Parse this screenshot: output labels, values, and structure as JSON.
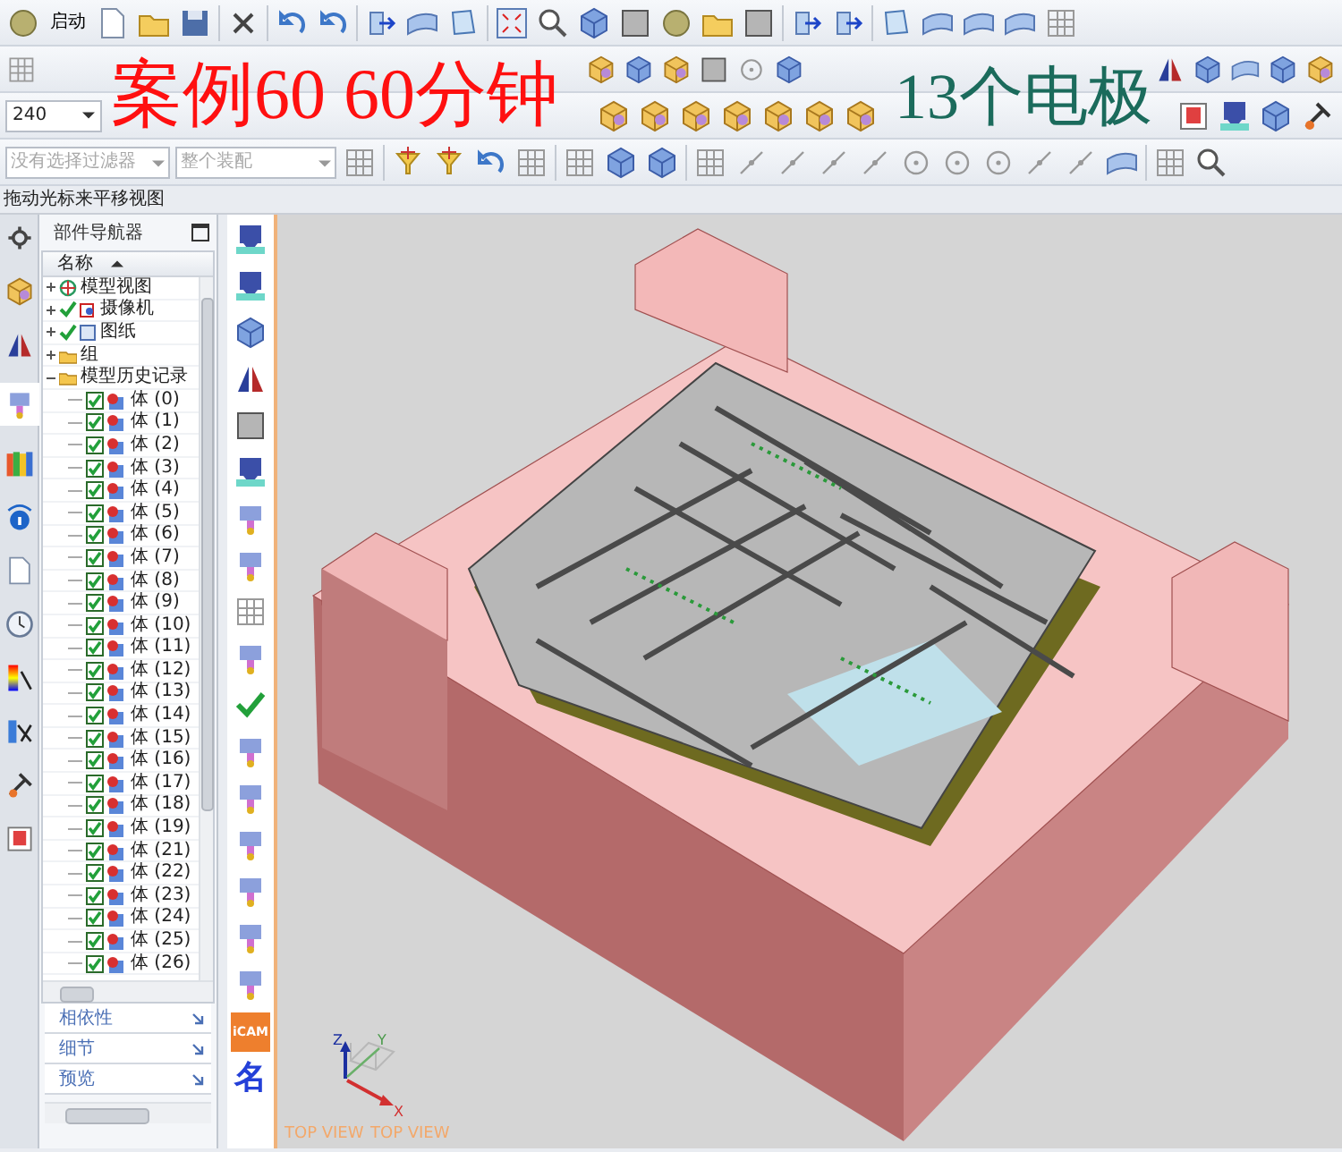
{
  "toolbar": {
    "start_button": "启动",
    "zoom_value": "240",
    "selection_filter": {
      "placeholder": "没有选择过滤器"
    },
    "assembly_scope": {
      "placeholder": "整个装配"
    }
  },
  "captions": [
    {
      "text": "案例60  60分钟",
      "kind": "title"
    },
    {
      "text": "13个电极",
      "kind": "note"
    }
  ],
  "status_line": "拖动光标来平移视图",
  "navigator": {
    "title": "部件导航器",
    "column": "名称",
    "tree": [
      {
        "label": "模型视图",
        "kind": "view",
        "expanded": false,
        "checked": false
      },
      {
        "label": "摄像机",
        "kind": "camera",
        "expanded": false,
        "checked": true
      },
      {
        "label": "图纸",
        "kind": "drawing",
        "expanded": false,
        "checked": true
      },
      {
        "label": "组",
        "kind": "folder",
        "expanded": false,
        "checked": false
      },
      {
        "label": "模型历史记录",
        "kind": "folder",
        "expanded": true,
        "checked": false,
        "children": [
          {
            "label": "体 (0)",
            "checked": true
          },
          {
            "label": "体 (1)",
            "checked": true
          },
          {
            "label": "体 (2)",
            "checked": true
          },
          {
            "label": "体 (3)",
            "checked": true
          },
          {
            "label": "体 (4)",
            "checked": true
          },
          {
            "label": "体 (5)",
            "checked": true
          },
          {
            "label": "体 (6)",
            "checked": true
          },
          {
            "label": "体 (7)",
            "checked": true
          },
          {
            "label": "体 (8)",
            "checked": true
          },
          {
            "label": "体 (9)",
            "checked": true
          },
          {
            "label": "体 (10)",
            "checked": true
          },
          {
            "label": "体 (11)",
            "checked": true
          },
          {
            "label": "体 (12)",
            "checked": true
          },
          {
            "label": "体 (13)",
            "checked": true
          },
          {
            "label": "体 (14)",
            "checked": true
          },
          {
            "label": "体 (15)",
            "checked": true
          },
          {
            "label": "体 (16)",
            "checked": true
          },
          {
            "label": "体 (17)",
            "checked": true
          },
          {
            "label": "体 (18)",
            "checked": true
          },
          {
            "label": "体 (19)",
            "checked": true
          },
          {
            "label": "体 (21)",
            "checked": true
          },
          {
            "label": "体 (22)",
            "checked": true
          },
          {
            "label": "体 (23)",
            "checked": true
          },
          {
            "label": "体 (24)",
            "checked": true
          },
          {
            "label": "体 (25)",
            "checked": true
          },
          {
            "label": "体 (26)",
            "checked": true
          }
        ]
      }
    ],
    "panels": [
      "相依性",
      "细节",
      "预览"
    ]
  },
  "side_toolbar": {
    "icam_button": "iCAM",
    "name_button": "名"
  },
  "viewport": {
    "axes": [
      "X",
      "Y",
      "Z"
    ],
    "view_labels": [
      "TOP VIEW",
      "TOP VIEW"
    ]
  }
}
